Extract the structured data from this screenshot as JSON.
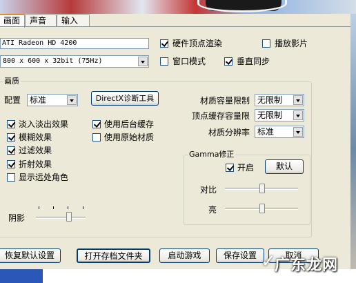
{
  "tabs": [
    {
      "label": "画面",
      "active": true
    },
    {
      "label": "声音",
      "active": false
    },
    {
      "label": "输入",
      "active": false
    }
  ],
  "display": {
    "adapter": "ATI Radeon HD 4200",
    "resolution": "800 x 600 x 32bit (75Hz)"
  },
  "top_options": {
    "hw_vertex": {
      "label": "硬件顶点渲染",
      "checked": true
    },
    "play_movie": {
      "label": "播放影片",
      "checked": false
    },
    "window_mode": {
      "label": "窗口模式",
      "checked": false
    },
    "vsync": {
      "label": "垂直同步",
      "checked": true
    }
  },
  "quality": {
    "group_title": "画质",
    "config_label": "配置",
    "config_value": "标准",
    "dx_button": "DirectX诊断工具",
    "checkboxes": [
      {
        "label": "淡入淡出效果",
        "checked": true
      },
      {
        "label": "模糊效果",
        "checked": true
      },
      {
        "label": "过滤效果",
        "checked": true
      },
      {
        "label": "折射效果",
        "checked": true
      },
      {
        "label": "显示远处角色",
        "checked": false
      }
    ],
    "checkboxes_right": [
      {
        "label": "使用后台缓存",
        "checked": true
      },
      {
        "label": "使用原始材质",
        "checked": false
      }
    ],
    "texture_limit": {
      "label": "材质容量限制",
      "value": "无限制"
    },
    "vertex_cache_limit": {
      "label": "顶点缓存容量限",
      "value": "无限制"
    },
    "texture_resolution": {
      "label": "材质分辨率",
      "value": "标准"
    },
    "shadow_label": "阴影"
  },
  "gamma": {
    "group_title": "Gamma修正",
    "enable_label": "开启",
    "enable_checked": true,
    "default_button": "默认",
    "contrast_label": "对比",
    "brightness_label": "亮"
  },
  "buttons": {
    "restore_default": "恢复默认设置",
    "open_save_folder": "打开存档文件夹",
    "start_game": "启动游戏",
    "save_settings": "保存设置",
    "cancel": "取消"
  },
  "watermark": {
    "text": "广东龙网"
  }
}
